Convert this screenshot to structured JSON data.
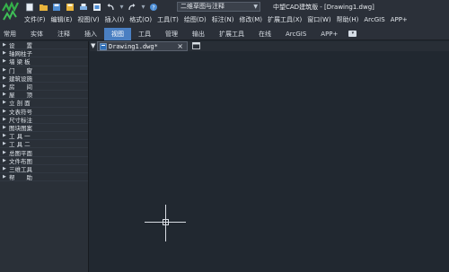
{
  "app": {
    "title": "中望CAD建筑版 - [Drawing1.dwg]",
    "workspace": "二维草图与注释"
  },
  "quick_access": [
    {
      "icon": "new-file-icon"
    },
    {
      "icon": "open-folder-icon"
    },
    {
      "icon": "save-icon"
    },
    {
      "icon": "save-as-icon"
    },
    {
      "icon": "print-icon"
    },
    {
      "icon": "plot-preview-icon"
    },
    {
      "icon": "undo-icon"
    },
    {
      "icon": "redo-icon"
    },
    {
      "icon": "help-icon"
    }
  ],
  "menu": [
    "文件(F)",
    "编辑(E)",
    "视图(V)",
    "插入(I)",
    "格式(O)",
    "工具(T)",
    "绘图(D)",
    "标注(N)",
    "修改(M)",
    "扩展工具(X)",
    "窗口(W)",
    "帮助(H)",
    "ArcGIS",
    "APP+"
  ],
  "ribbon_tabs": [
    {
      "label": "常用",
      "active": false
    },
    {
      "label": "实体",
      "active": false
    },
    {
      "label": "注释",
      "active": false
    },
    {
      "label": "插入",
      "active": false
    },
    {
      "label": "视图",
      "active": true
    },
    {
      "label": "工具",
      "active": false
    },
    {
      "label": "管理",
      "active": false
    },
    {
      "label": "输出",
      "active": false
    },
    {
      "label": "扩展工具",
      "active": false
    },
    {
      "label": "在线",
      "active": false
    },
    {
      "label": "ArcGIS",
      "active": false
    },
    {
      "label": "APP+",
      "active": false
    }
  ],
  "tool_panel": [
    "设　　置",
    "轴网柱子",
    "墙 梁 板",
    "门　　窗",
    "建筑设施",
    "房　　间",
    "屋　　顶",
    "立 剖 面",
    "文表符号",
    "尺寸标注",
    "图块图案",
    "工 具 一",
    "工 具 二",
    "总图平面",
    "文件布图",
    "三维工具",
    "帮　　助"
  ],
  "document": {
    "tab_name": "Drawing1.dwg*",
    "close_glyph": "×"
  },
  "colors": {
    "accent": "#4a7fc2",
    "canvas_bg": "#212830",
    "chrome_bg": "#2b3039"
  }
}
